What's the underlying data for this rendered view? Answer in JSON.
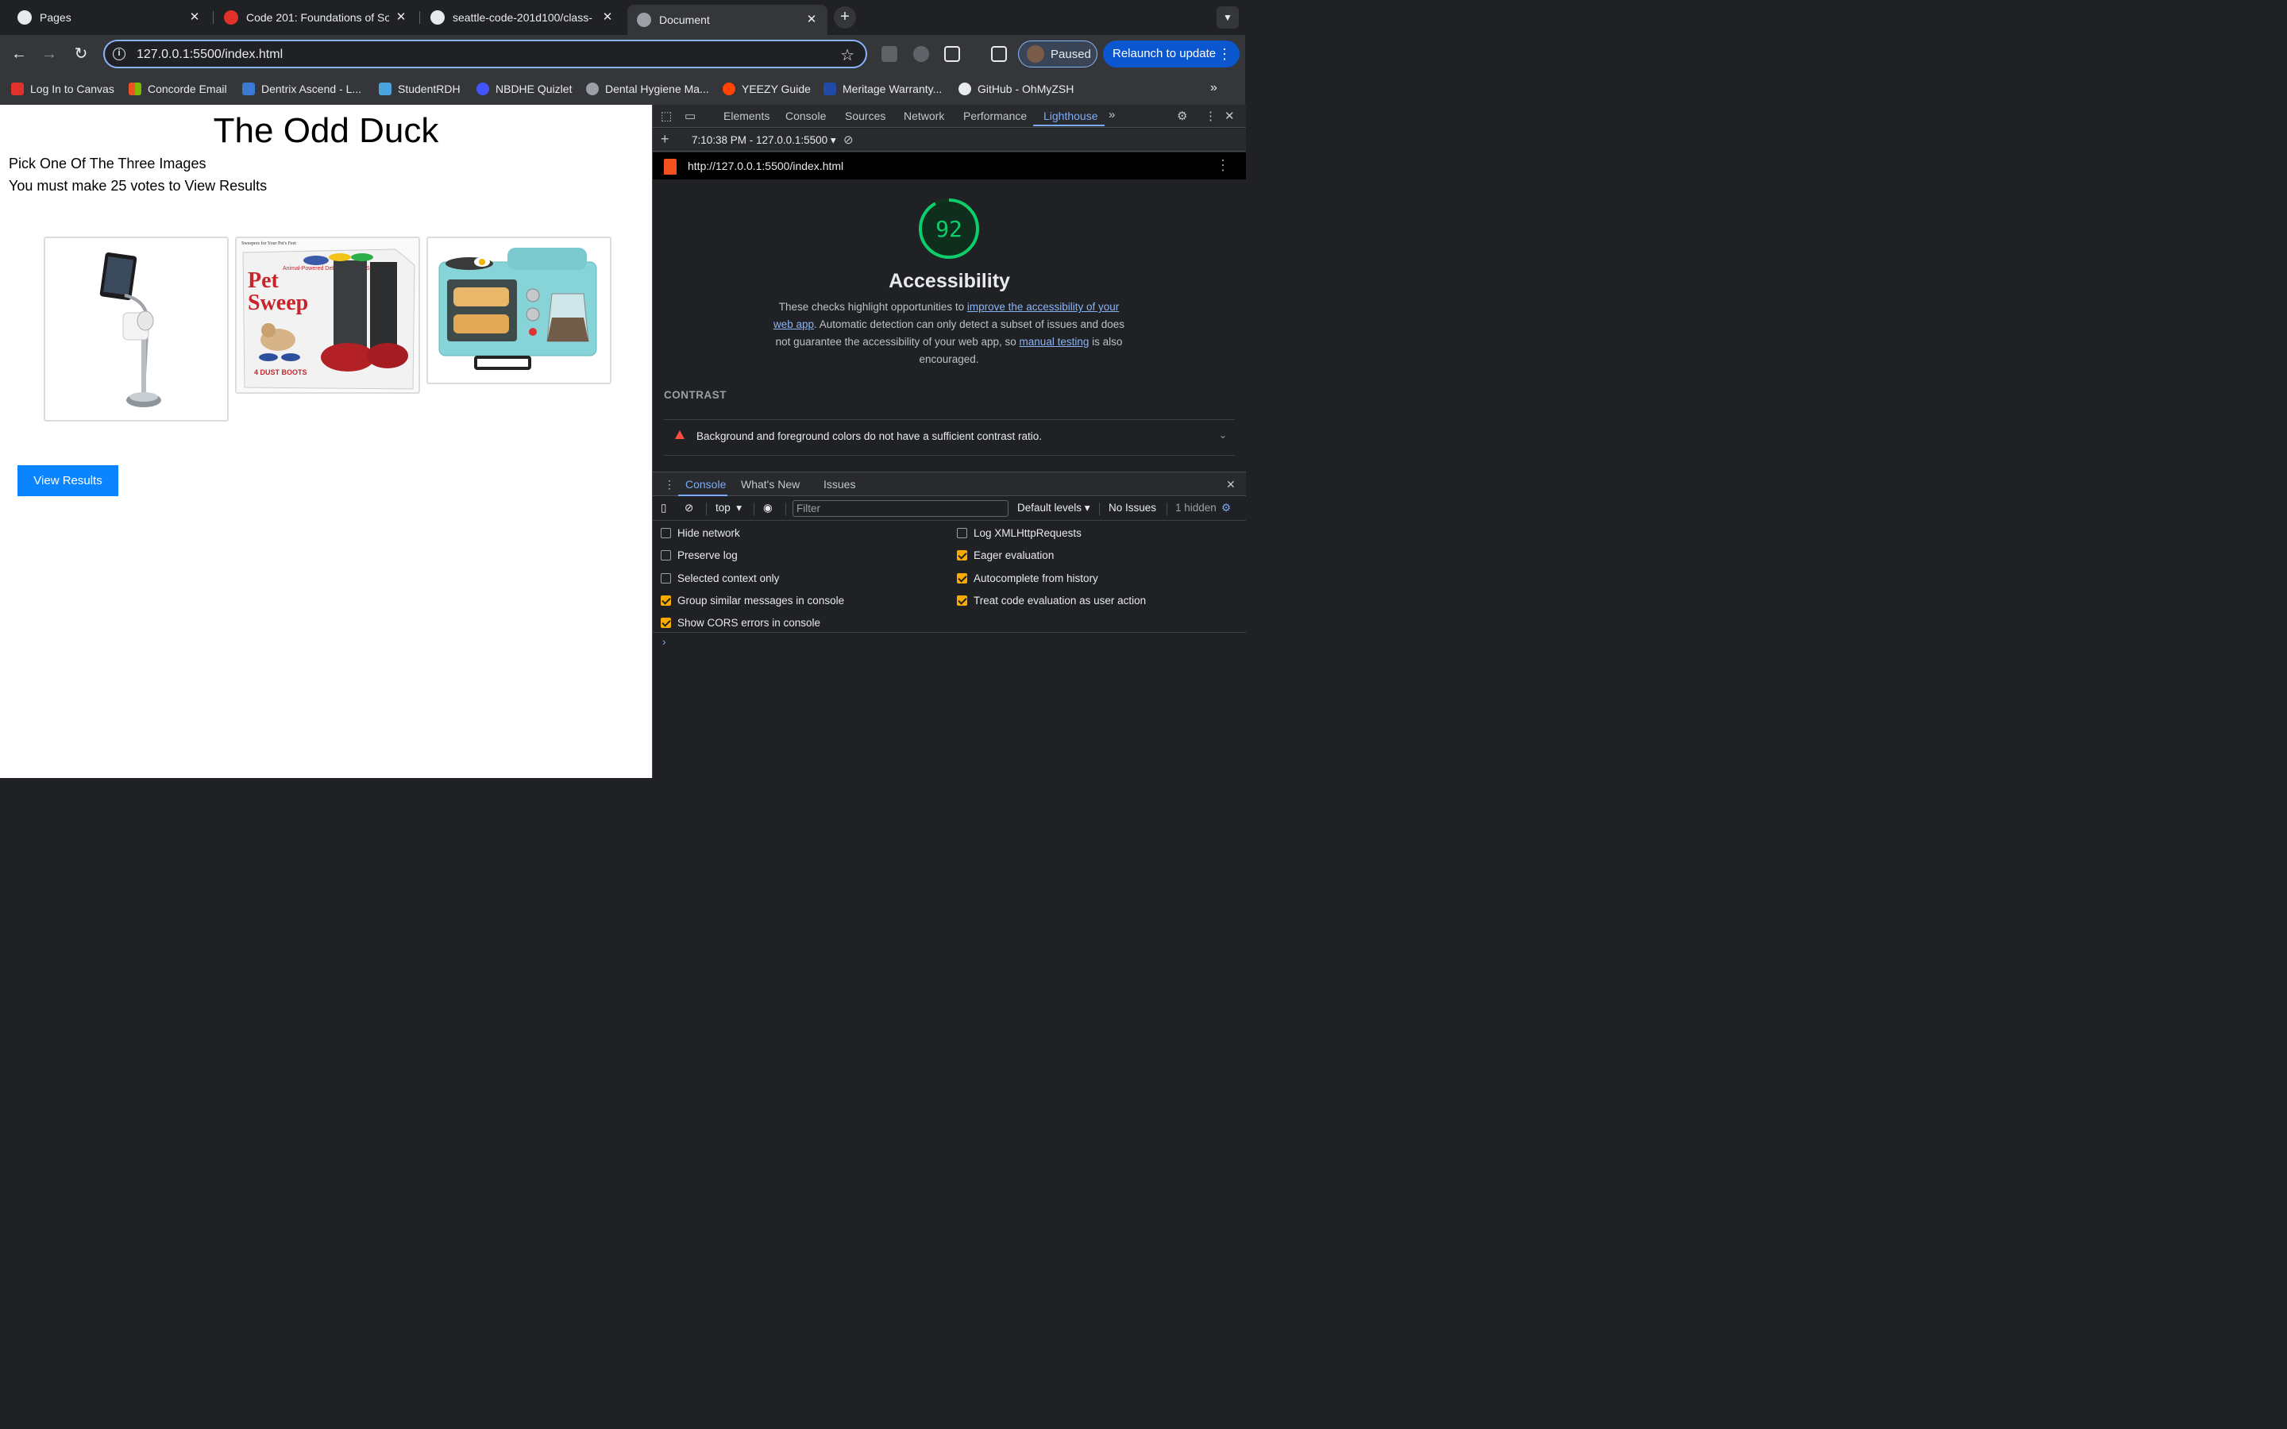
{
  "tabs": [
    {
      "title": "Pages",
      "icon": "github-icon",
      "active": false
    },
    {
      "title": "Code 201: Foundations of Sof",
      "icon": "canvas-icon",
      "active": false
    },
    {
      "title": "seattle-code-201d100/class-",
      "icon": "github-icon",
      "active": false
    },
    {
      "title": "Document",
      "icon": "globe-icon",
      "active": true
    }
  ],
  "toolbar": {
    "url": "127.0.0.1:5500/index.html",
    "profile_label": "Paused",
    "relaunch_label": "Relaunch to update"
  },
  "bookmarks": [
    {
      "label": "Log In to Canvas",
      "icon": "canvas-icon",
      "color": "#e0312b"
    },
    {
      "label": "Concorde Email",
      "icon": "microsoft-icon",
      "color": "#f25022"
    },
    {
      "label": "Dentrix Ascend - L...",
      "icon": "dentrix-icon",
      "color": "#3a7bd5"
    },
    {
      "label": "StudentRDH",
      "icon": "studentrdh-icon",
      "color": "#4aa3df"
    },
    {
      "label": "NBDHE Quizlet",
      "icon": "quizlet-icon",
      "color": "#4255ff"
    },
    {
      "label": "Dental Hygiene Ma...",
      "icon": "globe-icon",
      "color": "#9aa0a6"
    },
    {
      "label": "YEEZY Guide",
      "icon": "reddit-icon",
      "color": "#ff4500"
    },
    {
      "label": "Meritage Warranty...",
      "icon": "meritage-icon",
      "color": "#1f4aa8"
    },
    {
      "label": "GitHub - OhMyZSH",
      "icon": "github-icon",
      "color": "#e8eaed"
    }
  ],
  "page": {
    "heading": "The Odd Duck",
    "instruction1": "Pick One Of The Three Images",
    "instruction2": "You must make 25 votes to View Results",
    "products": [
      "ipad-toilet-paper-stand",
      "pet-sweep-boots",
      "breakfast-station-toaster"
    ],
    "pet_sweep": {
      "top_caption": "Sweepers for Your Pet's Feet",
      "brand": "Pet",
      "brand2": "Sweep",
      "tagline": "Animal-Powered Debris Removal System",
      "count": "4 DUST BOOTS"
    },
    "view_results_label": "View Results"
  },
  "devtools": {
    "tabs": [
      "Elements",
      "Console",
      "Sources",
      "Network",
      "Performance",
      "Lighthouse"
    ],
    "active_tab": "Lighthouse",
    "report_time": "7:10:38 PM - 127.0.0.1:5500",
    "report_url": "http://127.0.0.1:5500/index.html",
    "score": "92",
    "score_value": 0.92,
    "score_color": "#0cce6b",
    "category": "Accessibility",
    "desc_part1": "These checks highlight opportunities to ",
    "desc_link1": "improve the accessibility of your web app",
    "desc_part2": ". Automatic detection can only detect a subset of issues and does not guarantee the accessibility of your web app, so ",
    "desc_link2": "manual testing",
    "desc_part3": " is also encouraged.",
    "section": "CONTRAST",
    "audit": "Background and foreground colors do not have a sufficient contrast ratio."
  },
  "drawer": {
    "tabs": [
      "Console",
      "What's New",
      "Issues"
    ],
    "context": "top",
    "filter_placeholder": "Filter",
    "levels": "Default levels",
    "issues": "No Issues",
    "hidden": "1 hidden",
    "options_left": [
      {
        "label": "Hide network",
        "checked": false
      },
      {
        "label": "Preserve log",
        "checked": false
      },
      {
        "label": "Selected context only",
        "checked": false
      },
      {
        "label": "Group similar messages in console",
        "checked": true
      },
      {
        "label": "Show CORS errors in console",
        "checked": true
      }
    ],
    "options_right": [
      {
        "label": "Log XMLHttpRequests",
        "checked": false
      },
      {
        "label": "Eager evaluation",
        "checked": true
      },
      {
        "label": "Autocomplete from history",
        "checked": true
      },
      {
        "label": "Treat code evaluation as user action",
        "checked": true
      }
    ],
    "prompt": "›"
  }
}
